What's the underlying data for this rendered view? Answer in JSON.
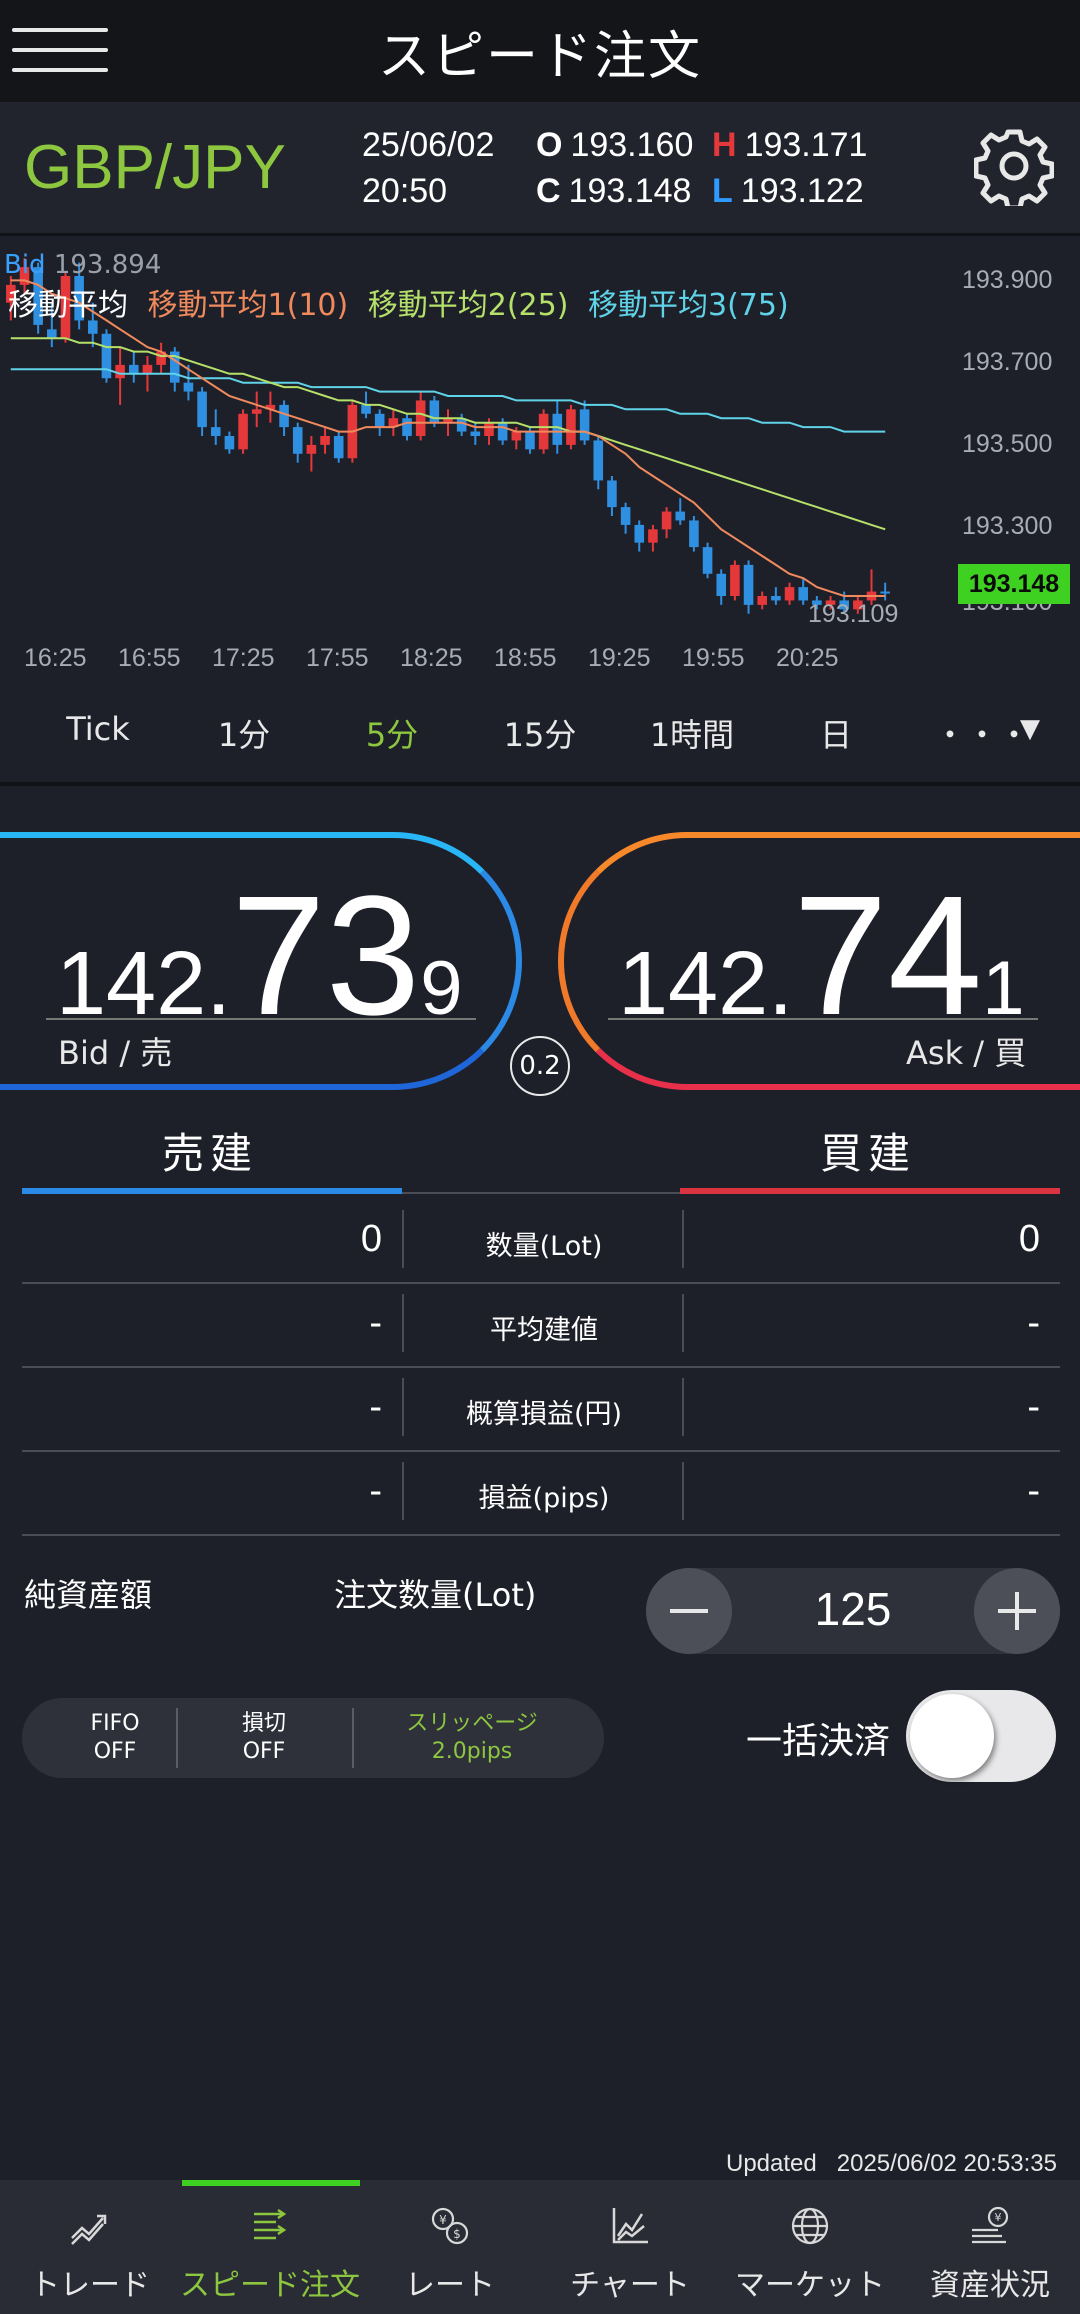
{
  "header": {
    "title": "スピード注文"
  },
  "info": {
    "pair": "GBP/JPY",
    "date": "25/06/02",
    "time": "20:50",
    "open_label": "O",
    "open": "193.160",
    "high_label": "H",
    "high": "193.171",
    "close_label": "C",
    "close": "193.148",
    "low_label": "L",
    "low": "193.122"
  },
  "chart_labels": {
    "bid": "Bid",
    "high_value": "193.894",
    "ma_title": "移動平均",
    "ma1": "移動平均1(10)",
    "ma2": "移動平均2(25)",
    "ma3": "移動平均3(75)",
    "current": "193.148",
    "low_marker": "193.109",
    "overlap_tick": "193.100"
  },
  "chart_data": {
    "type": "candlestick",
    "title": "",
    "xlabel": "",
    "ylabel": "",
    "ylim": [
      193.05,
      193.95
    ],
    "y_ticks": [
      "193.900",
      "193.700",
      "193.500",
      "193.300"
    ],
    "x_ticks": [
      "16:25",
      "16:55",
      "17:25",
      "17:55",
      "18:25",
      "18:55",
      "19:25",
      "19:55",
      "20:25"
    ],
    "colors": {
      "up": "#e5383b",
      "down": "#2f8fe0",
      "ma1": "#f08a5d",
      "ma2": "#b5e06a",
      "ma3": "#5fd3e8"
    },
    "candles": [
      [
        193.8,
        193.86,
        193.76,
        193.84
      ],
      [
        193.84,
        193.9,
        193.82,
        193.88
      ],
      [
        193.88,
        193.89,
        193.73,
        193.75
      ],
      [
        193.74,
        193.8,
        193.7,
        193.72
      ],
      [
        193.72,
        193.87,
        193.71,
        193.86
      ],
      [
        193.86,
        193.89,
        193.74,
        193.76
      ],
      [
        193.76,
        193.8,
        193.7,
        193.73
      ],
      [
        193.73,
        193.74,
        193.62,
        193.63
      ],
      [
        193.63,
        193.7,
        193.57,
        193.66
      ],
      [
        193.66,
        193.69,
        193.62,
        193.64
      ],
      [
        193.64,
        193.68,
        193.6,
        193.66
      ],
      [
        193.66,
        193.71,
        193.64,
        193.69
      ],
      [
        193.69,
        193.7,
        193.6,
        193.62
      ],
      [
        193.62,
        193.66,
        193.58,
        193.6
      ],
      [
        193.6,
        193.61,
        193.5,
        193.52
      ],
      [
        193.52,
        193.56,
        193.48,
        193.5
      ],
      [
        193.5,
        193.51,
        193.46,
        193.47
      ],
      [
        193.47,
        193.56,
        193.46,
        193.55
      ],
      [
        193.55,
        193.6,
        193.52,
        193.56
      ],
      [
        193.56,
        193.6,
        193.53,
        193.57
      ],
      [
        193.57,
        193.58,
        193.5,
        193.52
      ],
      [
        193.52,
        193.53,
        193.44,
        193.46
      ],
      [
        193.46,
        193.5,
        193.42,
        193.48
      ],
      [
        193.48,
        193.52,
        193.46,
        193.5
      ],
      [
        193.5,
        193.51,
        193.44,
        193.45
      ],
      [
        193.45,
        193.58,
        193.44,
        193.57
      ],
      [
        193.57,
        193.6,
        193.54,
        193.55
      ],
      [
        193.55,
        193.56,
        193.5,
        193.52
      ],
      [
        193.52,
        193.56,
        193.5,
        193.54
      ],
      [
        193.54,
        193.55,
        193.49,
        193.5
      ],
      [
        193.5,
        193.6,
        193.49,
        193.58
      ],
      [
        193.58,
        193.59,
        193.52,
        193.53
      ],
      [
        193.53,
        193.56,
        193.5,
        193.54
      ],
      [
        193.54,
        193.55,
        193.5,
        193.51
      ],
      [
        193.51,
        193.53,
        193.48,
        193.5
      ],
      [
        193.5,
        193.54,
        193.48,
        193.53
      ],
      [
        193.53,
        193.54,
        193.48,
        193.49
      ],
      [
        193.49,
        193.52,
        193.47,
        193.51
      ],
      [
        193.51,
        193.52,
        193.46,
        193.47
      ],
      [
        193.47,
        193.56,
        193.46,
        193.55
      ],
      [
        193.55,
        193.58,
        193.46,
        193.48
      ],
      [
        193.48,
        193.57,
        193.47,
        193.56
      ],
      [
        193.56,
        193.58,
        193.48,
        193.49
      ],
      [
        193.49,
        193.5,
        193.38,
        193.4
      ],
      [
        193.4,
        193.41,
        193.32,
        193.34
      ],
      [
        193.34,
        193.35,
        193.28,
        193.3
      ],
      [
        193.3,
        193.31,
        193.24,
        193.26
      ],
      [
        193.26,
        193.3,
        193.24,
        193.29
      ],
      [
        193.29,
        193.34,
        193.27,
        193.33
      ],
      [
        193.33,
        193.36,
        193.3,
        193.31
      ],
      [
        193.31,
        193.32,
        193.24,
        193.25
      ],
      [
        193.25,
        193.26,
        193.18,
        193.19
      ],
      [
        193.19,
        193.2,
        193.12,
        193.14
      ],
      [
        193.14,
        193.22,
        193.13,
        193.21
      ],
      [
        193.21,
        193.22,
        193.1,
        193.12
      ],
      [
        193.12,
        193.15,
        193.11,
        193.14
      ],
      [
        193.14,
        193.16,
        193.12,
        193.13
      ],
      [
        193.13,
        193.17,
        193.12,
        193.16
      ],
      [
        193.16,
        193.18,
        193.12,
        193.13
      ],
      [
        193.13,
        193.14,
        193.11,
        193.12
      ],
      [
        193.12,
        193.14,
        193.11,
        193.13
      ],
      [
        193.13,
        193.15,
        193.1,
        193.11
      ],
      [
        193.11,
        193.14,
        193.1,
        193.13
      ],
      [
        193.13,
        193.2,
        193.12,
        193.15
      ],
      [
        193.15,
        193.17,
        193.13,
        193.148
      ]
    ],
    "ma1": [
      193.85,
      193.85,
      193.84,
      193.82,
      193.81,
      193.8,
      193.78,
      193.76,
      193.74,
      193.72,
      193.7,
      193.69,
      193.67,
      193.65,
      193.63,
      193.61,
      193.59,
      193.58,
      193.57,
      193.56,
      193.55,
      193.54,
      193.53,
      193.52,
      193.51,
      193.51,
      193.52,
      193.52,
      193.52,
      193.53,
      193.53,
      193.53,
      193.53,
      193.53,
      193.52,
      193.52,
      193.52,
      193.51,
      193.51,
      193.51,
      193.51,
      193.51,
      193.51,
      193.5,
      193.48,
      193.46,
      193.43,
      193.41,
      193.39,
      193.37,
      193.35,
      193.32,
      193.29,
      193.27,
      193.25,
      193.23,
      193.21,
      193.19,
      193.18,
      193.16,
      193.15,
      193.14,
      193.14,
      193.14,
      193.14
    ],
    "ma2": [
      193.72,
      193.72,
      193.72,
      193.72,
      193.72,
      193.71,
      193.71,
      193.7,
      193.7,
      193.69,
      193.69,
      193.68,
      193.68,
      193.67,
      193.66,
      193.65,
      193.64,
      193.64,
      193.63,
      193.62,
      193.61,
      193.61,
      193.6,
      193.59,
      193.58,
      193.58,
      193.57,
      193.57,
      193.56,
      193.55,
      193.55,
      193.54,
      193.54,
      193.54,
      193.53,
      193.53,
      193.53,
      193.53,
      193.52,
      193.52,
      193.52,
      193.51,
      193.51,
      193.5,
      193.49,
      193.48,
      193.47,
      193.46,
      193.45,
      193.44,
      193.43,
      193.42,
      193.41,
      193.4,
      193.39,
      193.38,
      193.37,
      193.36,
      193.35,
      193.34,
      193.33,
      193.32,
      193.31,
      193.3,
      193.29
    ],
    "ma3": [
      193.65,
      193.65,
      193.65,
      193.65,
      193.65,
      193.65,
      193.65,
      193.65,
      193.64,
      193.64,
      193.64,
      193.64,
      193.64,
      193.63,
      193.63,
      193.63,
      193.63,
      193.62,
      193.62,
      193.62,
      193.62,
      193.62,
      193.61,
      193.61,
      193.61,
      193.61,
      193.61,
      193.6,
      193.6,
      193.6,
      193.6,
      193.6,
      193.59,
      193.59,
      193.59,
      193.59,
      193.59,
      193.58,
      193.58,
      193.58,
      193.58,
      193.58,
      193.57,
      193.57,
      193.57,
      193.56,
      193.56,
      193.56,
      193.56,
      193.55,
      193.55,
      193.55,
      193.54,
      193.54,
      193.54,
      193.53,
      193.53,
      193.53,
      193.52,
      193.52,
      193.52,
      193.51,
      193.51,
      193.51,
      193.51
    ]
  },
  "timeframes": {
    "items": [
      "Tick",
      "1分",
      "5分",
      "15分",
      "1時間",
      "日"
    ],
    "active": "5分",
    "more": "・・・",
    "dropdown": "▼"
  },
  "quote": {
    "bid_prefix": "142.",
    "bid_big": "73",
    "bid_pip": "9",
    "bid_label": "Bid / 売",
    "ask_prefix": "142.",
    "ask_big": "74",
    "ask_pip": "1",
    "ask_label": "Ask / 買",
    "spread": "0.2",
    "colors": {
      "bid": "#2b8ae6",
      "ask": "#f07a2a"
    }
  },
  "positions": {
    "sell_header": "売建",
    "buy_header": "買建",
    "rows": [
      {
        "label": "数量(Lot)",
        "sell": "0",
        "buy": "0"
      },
      {
        "label": "平均建値",
        "sell": "-",
        "buy": "-"
      },
      {
        "label": "概算損益(円)",
        "sell": "-",
        "buy": "-"
      },
      {
        "label": "損益(pips)",
        "sell": "-",
        "buy": "-"
      }
    ]
  },
  "order": {
    "net_assets_label": "純資産額",
    "qty_label": "注文数量(Lot)",
    "qty_value": "125",
    "fifo_label": "FIFO",
    "fifo_value": "OFF",
    "stop_label": "損切",
    "stop_value": "OFF",
    "slip_label": "スリッページ",
    "slip_value": "2.0pips",
    "bulk_label": "一括決済",
    "bulk_on": false
  },
  "updated": {
    "label": "Updated",
    "datetime": "2025/06/02  20:53:35"
  },
  "nav": {
    "items": [
      {
        "label": "トレード",
        "icon": "trade-icon"
      },
      {
        "label": "スピード注文",
        "icon": "speed-order-icon"
      },
      {
        "label": "レート",
        "icon": "rate-icon"
      },
      {
        "label": "チャート",
        "icon": "chart-icon"
      },
      {
        "label": "マーケット",
        "icon": "market-globe-icon"
      },
      {
        "label": "資産状況",
        "icon": "assets-icon"
      }
    ],
    "active_index": 1
  }
}
